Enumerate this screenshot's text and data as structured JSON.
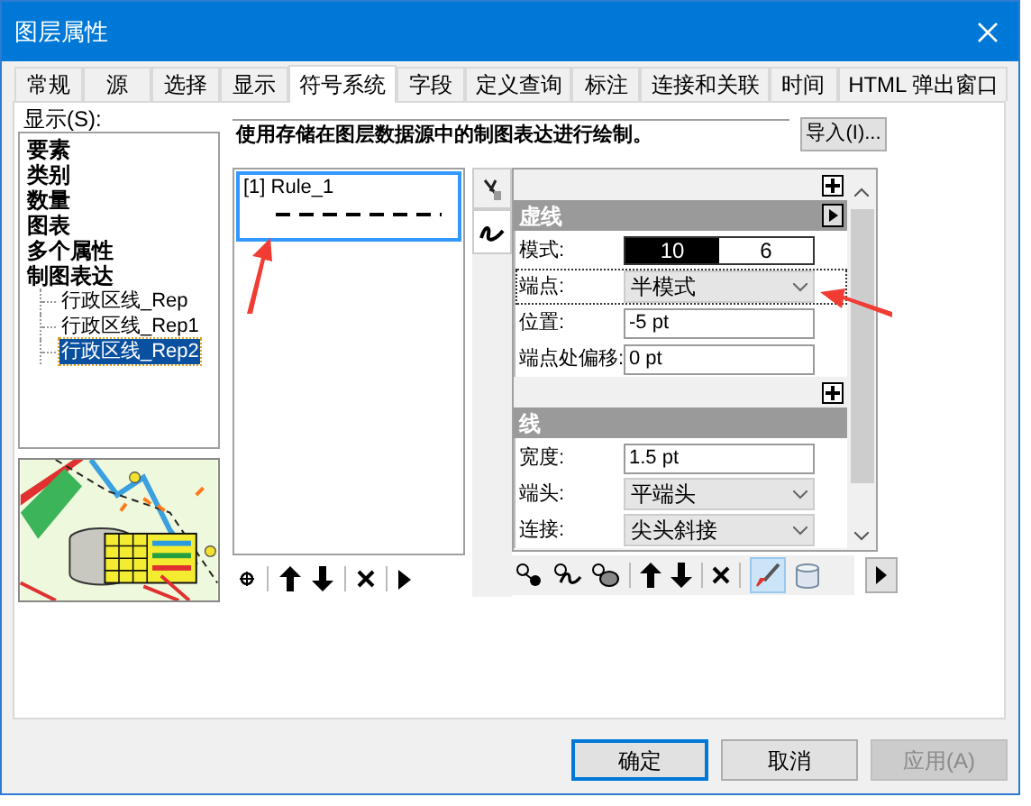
{
  "window": {
    "title": "图层属性"
  },
  "tabs": [
    {
      "label": "常规",
      "selected": false
    },
    {
      "label": "源",
      "selected": false
    },
    {
      "label": "选择",
      "selected": false
    },
    {
      "label": "显示",
      "selected": false
    },
    {
      "label": "符号系统",
      "selected": true
    },
    {
      "label": "字段",
      "selected": false
    },
    {
      "label": "定义查询",
      "selected": false
    },
    {
      "label": "标注",
      "selected": false
    },
    {
      "label": "连接和关联",
      "selected": false
    },
    {
      "label": "时间",
      "selected": false
    },
    {
      "label": "HTML 弹出窗口",
      "selected": false
    }
  ],
  "show_label": "显示(S):",
  "tree": [
    {
      "label": "要素",
      "selected": false
    },
    {
      "label": "类别",
      "selected": false
    },
    {
      "label": "数量",
      "selected": false
    },
    {
      "label": "图表",
      "selected": false
    },
    {
      "label": "多个属性",
      "selected": false
    },
    {
      "label": "制图表达",
      "selected": false,
      "children": [
        {
          "label": "行政区线_Rep",
          "selected": false
        },
        {
          "label": "行政区线_Rep1",
          "selected": false
        },
        {
          "label": "行政区线_Rep2",
          "selected": true
        }
      ]
    }
  ],
  "description": "使用存储在图层数据源中的制图表达进行绘制。",
  "import_button": "导入(I)...",
  "rules": [
    {
      "label": "[1] Rule_1",
      "selected": true
    }
  ],
  "sections": [
    {
      "title": "虚线",
      "rows": [
        {
          "kind": "pattern",
          "label": "模式:",
          "values": [
            "10",
            "6"
          ]
        },
        {
          "kind": "dropdown",
          "label": "端点:",
          "value": "半模式",
          "focused": true
        },
        {
          "kind": "text",
          "label": "位置:",
          "value": "-5 pt"
        },
        {
          "kind": "text",
          "label": "端点处偏移:",
          "value": "0 pt"
        }
      ]
    },
    {
      "title": "线",
      "rows": [
        {
          "kind": "text",
          "label": "宽度:",
          "value": "1.5 pt"
        },
        {
          "kind": "dropdown",
          "label": "端头:",
          "value": "平端头",
          "focused": false
        },
        {
          "kind": "dropdown",
          "label": "连接:",
          "value": "尖头斜接",
          "focused": false
        }
      ]
    }
  ],
  "buttons": [
    {
      "label": "确定",
      "default": true,
      "disabled": false
    },
    {
      "label": "取消",
      "default": false,
      "disabled": false
    },
    {
      "label": "应用(A)",
      "default": false,
      "disabled": true
    }
  ]
}
